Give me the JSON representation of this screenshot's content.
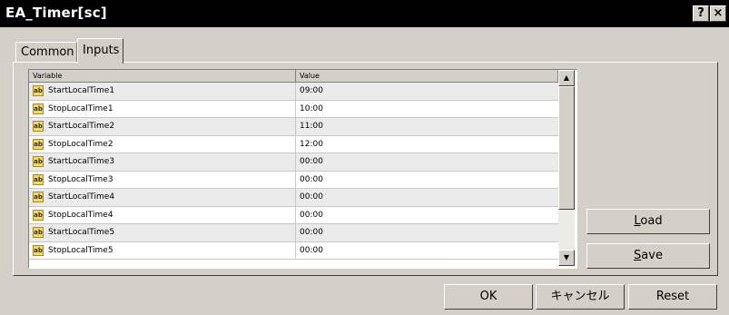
{
  "window": {
    "title": "EA_Timer[sc]",
    "help_label": "?",
    "close_label": "×"
  },
  "tabs": [
    {
      "label": "Common",
      "selected": false
    },
    {
      "label": "Inputs",
      "selected": true
    }
  ],
  "grid": {
    "columns": [
      "Variable",
      "Value"
    ],
    "icon_text": "ab",
    "rows": [
      {
        "variable": "StartLocalTime1",
        "value": "09:00"
      },
      {
        "variable": "StopLocalTime1",
        "value": "10:00"
      },
      {
        "variable": "StartLocalTime2",
        "value": "11:00"
      },
      {
        "variable": "StopLocalTime2",
        "value": "12:00"
      },
      {
        "variable": "StartLocalTime3",
        "value": "00:00"
      },
      {
        "variable": "StopLocalTime3",
        "value": "00:00"
      },
      {
        "variable": "StartLocalTime4",
        "value": "00:00"
      },
      {
        "variable": "StopLocalTime4",
        "value": "00:00"
      },
      {
        "variable": "StartLocalTime5",
        "value": "00:00"
      },
      {
        "variable": "StopLocalTime5",
        "value": "00:00"
      }
    ],
    "scroll_up_glyph": "▲",
    "scroll_down_glyph": "▼"
  },
  "side_buttons": {
    "load": {
      "mnemonic": "L",
      "rest": "oad"
    },
    "save": {
      "mnemonic": "S",
      "rest": "ave"
    }
  },
  "footer_buttons": {
    "ok": "OK",
    "cancel": "キャンセル",
    "reset": "Reset"
  }
}
